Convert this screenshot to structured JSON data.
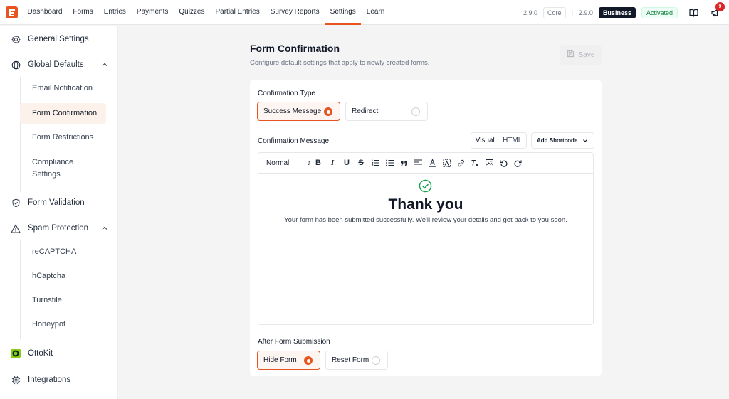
{
  "topbar": {
    "nav": [
      "Dashboard",
      "Forms",
      "Entries",
      "Payments",
      "Quizzes",
      "Partial Entries",
      "Survey Reports",
      "Settings",
      "Learn"
    ],
    "active_nav": "Settings",
    "version_core": "2.9.0",
    "core_label": "Core",
    "separator": "|",
    "version_business": "2.9.0",
    "business_label": "Business",
    "activated_label": "Activated",
    "notification_count": "9"
  },
  "sidebar": {
    "general_settings": "General Settings",
    "global_defaults": "Global Defaults",
    "global_sub": [
      "Email Notification",
      "Form Confirmation",
      "Form Restrictions",
      "Compliance Settings"
    ],
    "form_validation": "Form Validation",
    "spam_protection": "Spam Protection",
    "spam_sub": [
      "reCAPTCHA",
      "hCaptcha",
      "Turnstile",
      "Honeypot"
    ],
    "ottokit": "OttoKit",
    "integrations": "Integrations"
  },
  "main": {
    "title": "Form Confirmation",
    "subtitle": "Configure default settings that apply to newly created forms.",
    "save_label": "Save",
    "confirmation_type_label": "Confirmation Type",
    "confirmation_options": [
      "Success Message",
      "Redirect"
    ],
    "confirmation_selected": "Success Message",
    "confirmation_message_label": "Confirmation Message",
    "editor_modes": [
      "Visual",
      "HTML"
    ],
    "editor_mode_selected": "Visual",
    "add_shortcode_label": "Add Shortcode",
    "toolbar_format": "Normal",
    "toolbar_format_arrows": "⇕",
    "message_title": "Thank you",
    "message_body": "Your form has been submitted successfully. We'll review your details and get back to you soon.",
    "after_submission_label": "After Form Submission",
    "after_options": [
      "Hide Form",
      "Reset Form"
    ],
    "after_selected": "Hide Form"
  },
  "colors": {
    "accent": "#e8541f",
    "success": "#16a34a",
    "badge": "#dc2626"
  }
}
